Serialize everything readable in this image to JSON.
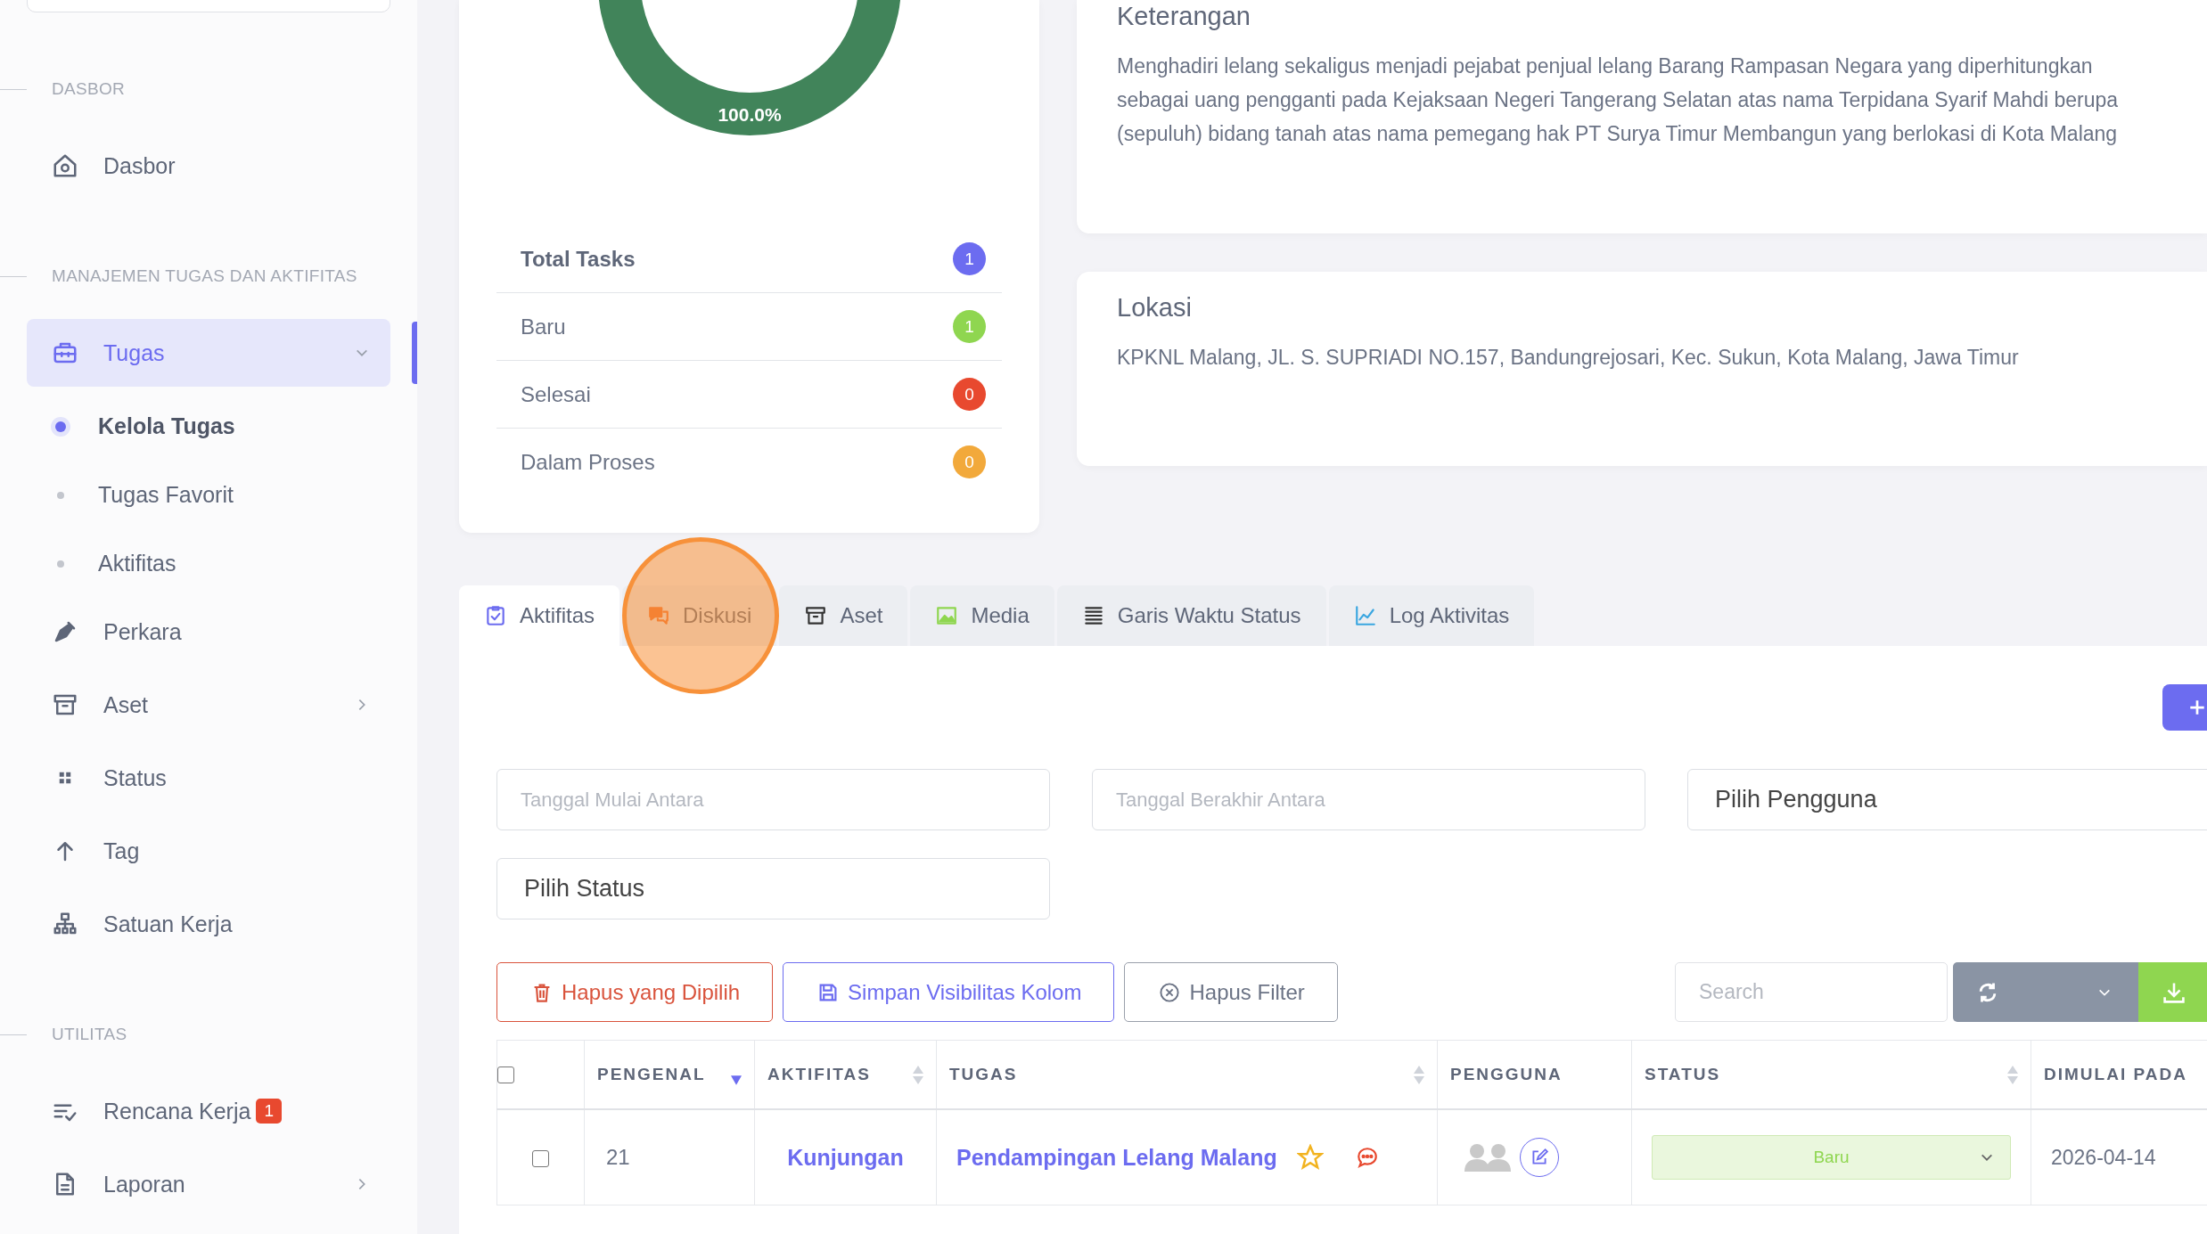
{
  "sidebar": {
    "sections": [
      {
        "title": "DASBOR",
        "items": [
          {
            "label": "Dasbor",
            "kind": "link",
            "selected": false
          }
        ]
      },
      {
        "title": "MANAJEMEN TUGAS DAN AKTIFITAS",
        "items": [
          {
            "label": "Tugas",
            "kind": "group",
            "selected": true,
            "expanded": true,
            "children": [
              {
                "label": "Kelola Tugas",
                "selected": true
              },
              {
                "label": "Tugas Favorit",
                "selected": false
              },
              {
                "label": "Aktifitas",
                "selected": false
              }
            ]
          },
          {
            "label": "Perkara",
            "kind": "link",
            "selected": false
          },
          {
            "label": "Aset",
            "kind": "group",
            "selected": false,
            "expanded": false
          },
          {
            "label": "Status",
            "kind": "link",
            "selected": false
          },
          {
            "label": "Tag",
            "kind": "link",
            "selected": false
          },
          {
            "label": "Satuan Kerja",
            "kind": "link",
            "selected": false
          }
        ]
      },
      {
        "title": "UTILITAS",
        "items": [
          {
            "label": "Rencana Kerja",
            "kind": "link",
            "selected": false,
            "badge": "1"
          },
          {
            "label": "Laporan",
            "kind": "group",
            "selected": false,
            "expanded": false
          }
        ]
      }
    ]
  },
  "summary": {
    "donut_label": "100.0%",
    "stats": [
      {
        "label": "Total Tasks",
        "count": "1",
        "kind": "total",
        "color": "#6c6cf0"
      },
      {
        "label": "Baru",
        "count": "1",
        "kind": "status",
        "color": "#8fd650"
      },
      {
        "label": "Selesai",
        "count": "0",
        "kind": "status",
        "color": "#e8492f"
      },
      {
        "label": "Dalam Proses",
        "count": "0",
        "kind": "status",
        "color": "#f2a93b"
      }
    ]
  },
  "description": {
    "title": "Keterangan",
    "text": "Menghadiri lelang sekaligus menjadi pejabat penjual lelang Barang Rampasan Negara yang diperhitungkan sebagai uang pengganti pada Kejaksaan Negeri Tangerang Selatan atas nama Terpidana Syarif Mahdi berupa (sepuluh) bidang tanah atas nama pemegang hak PT Surya Timur Membangun yang berlokasi di Kota Malang"
  },
  "location": {
    "title": "Lokasi",
    "text": "KPKNL Malang, JL. S. SUPRIADI NO.157, Bandungrejosari, Kec. Sukun, Kota Malang, Jawa Timur"
  },
  "tabs": [
    {
      "label": "Aktifitas",
      "selected": true,
      "clicked": false
    },
    {
      "label": "Diskusi",
      "selected": false,
      "clicked": true
    },
    {
      "label": "Aset",
      "selected": false,
      "clicked": false
    },
    {
      "label": "Media",
      "selected": false,
      "clicked": false
    },
    {
      "label": "Garis Waktu Status",
      "selected": false,
      "clicked": false
    },
    {
      "label": "Log Aktivitas",
      "selected": false,
      "clicked": false
    }
  ],
  "filters": [
    {
      "kind": "date",
      "placeholder": "Tanggal Mulai Antara"
    },
    {
      "kind": "date",
      "placeholder": "Tanggal Berakhir Antara"
    },
    {
      "kind": "select",
      "value": "Pilih Pengguna"
    },
    {
      "kind": "select",
      "value": "Pilih Status"
    }
  ],
  "actions": [
    {
      "label": "Hapus yang Dipilih",
      "kind": "danger"
    },
    {
      "label": "Simpan Visibilitas Kolom",
      "kind": "primary"
    },
    {
      "label": "Hapus Filter",
      "kind": "neutral"
    }
  ],
  "search": {
    "placeholder": "Search"
  },
  "table": {
    "columns": [
      {
        "kind": "checkbox",
        "checked": false
      },
      {
        "kind": "text",
        "label": "PENGENAL",
        "sortable": true,
        "sorted": true
      },
      {
        "kind": "text",
        "label": "AKTIFITAS",
        "sortable": true,
        "sorted": false
      },
      {
        "kind": "text",
        "label": "TUGAS",
        "sortable": true,
        "sorted": false
      },
      {
        "kind": "text",
        "label": "PENGGUNA",
        "sortable": false,
        "sorted": false
      },
      {
        "kind": "text",
        "label": "STATUS",
        "sortable": true,
        "sorted": false
      },
      {
        "kind": "text",
        "label": "DIMULAI PADA",
        "sortable": false,
        "sorted": false
      }
    ],
    "rows": [
      {
        "checked": false,
        "id": "21",
        "activity": "Kunjungan",
        "task": "Pendampingan Lelang Malang",
        "favorite": false,
        "status": "Baru",
        "started": "2026-04-14"
      }
    ]
  }
}
